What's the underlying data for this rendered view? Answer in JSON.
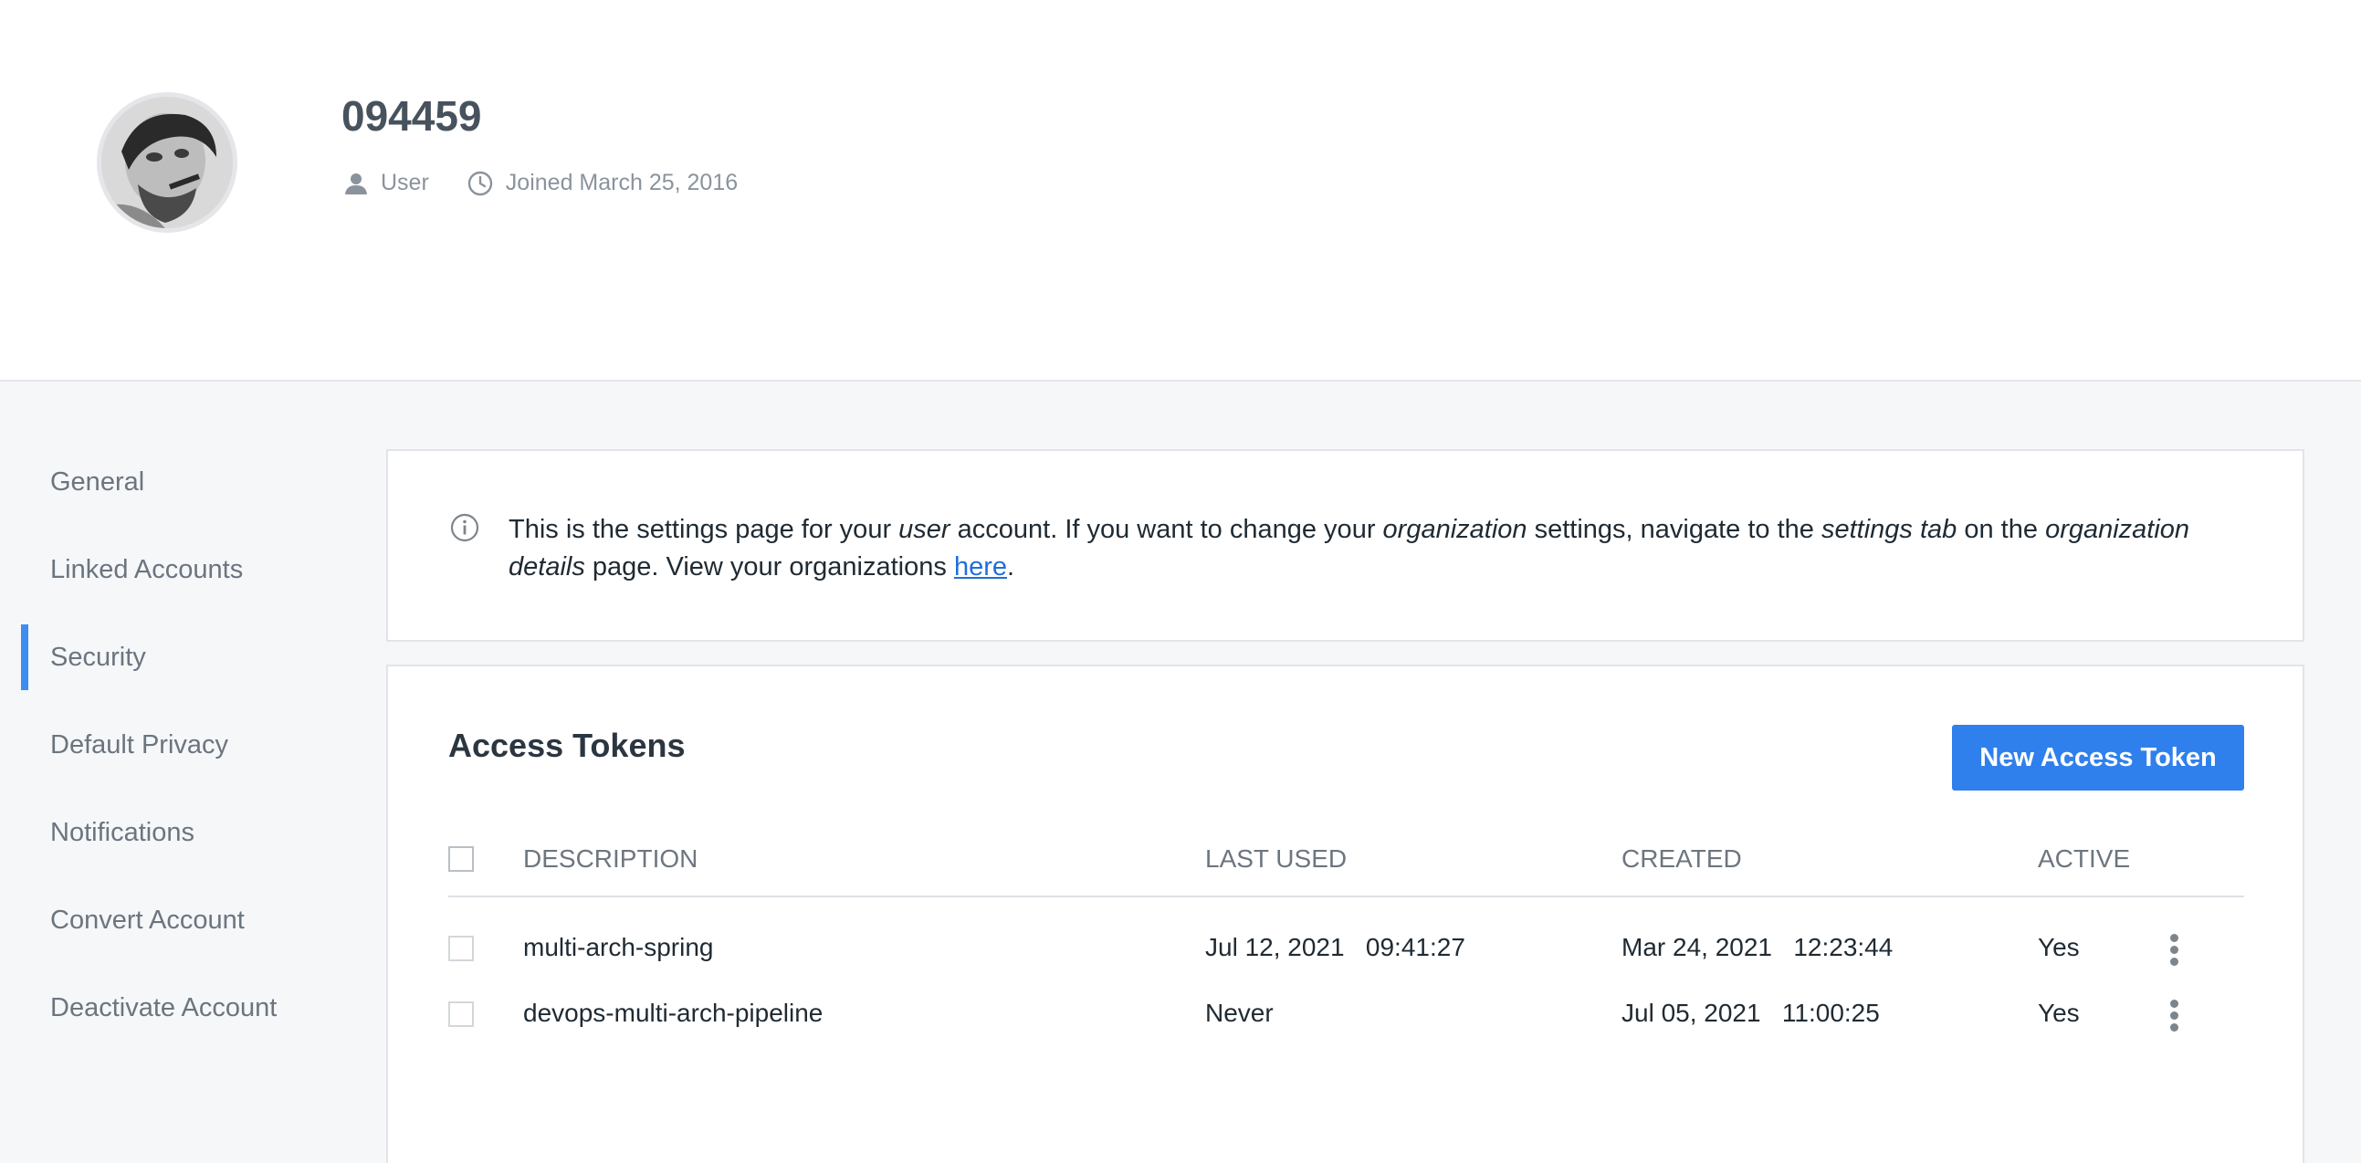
{
  "profile": {
    "username": "094459",
    "role": "User",
    "joined": "Joined March 25, 2016"
  },
  "sidebar": {
    "items": [
      {
        "label": "General",
        "active": false
      },
      {
        "label": "Linked Accounts",
        "active": false
      },
      {
        "label": "Security",
        "active": true
      },
      {
        "label": "Default Privacy",
        "active": false
      },
      {
        "label": "Notifications",
        "active": false
      },
      {
        "label": "Convert Account",
        "active": false
      },
      {
        "label": "Deactivate Account",
        "active": false
      }
    ]
  },
  "info": {
    "part1": "This is the settings page for your ",
    "em1": "user",
    "part2": " account. If you want to change your ",
    "em2": "organization",
    "part3": " settings, navigate to the ",
    "em3": "settings tab",
    "part4": " on the ",
    "em4": "organization details",
    "part5": " page. View your organizations ",
    "link": "here",
    "part6": "."
  },
  "tokens": {
    "title": "Access Tokens",
    "new_button": "New Access Token",
    "headers": {
      "description": "DESCRIPTION",
      "last_used": "LAST USED",
      "created": "CREATED",
      "active": "ACTIVE"
    },
    "rows": [
      {
        "description": "multi-arch-spring",
        "last_used": "Jul 12, 2021   09:41:27",
        "created": "Mar 24, 2021   12:23:44",
        "active": "Yes"
      },
      {
        "description": "devops-multi-arch-pipeline",
        "last_used": "Never",
        "created": "Jul 05, 2021   11:00:25",
        "active": "Yes"
      }
    ]
  },
  "colors": {
    "accent": "#2f80ed",
    "active_indicator": "#3d8ef0",
    "link": "#1f6fd8"
  },
  "icons": [
    "user-icon",
    "clock-icon",
    "info-icon",
    "kebab-menu-icon"
  ]
}
